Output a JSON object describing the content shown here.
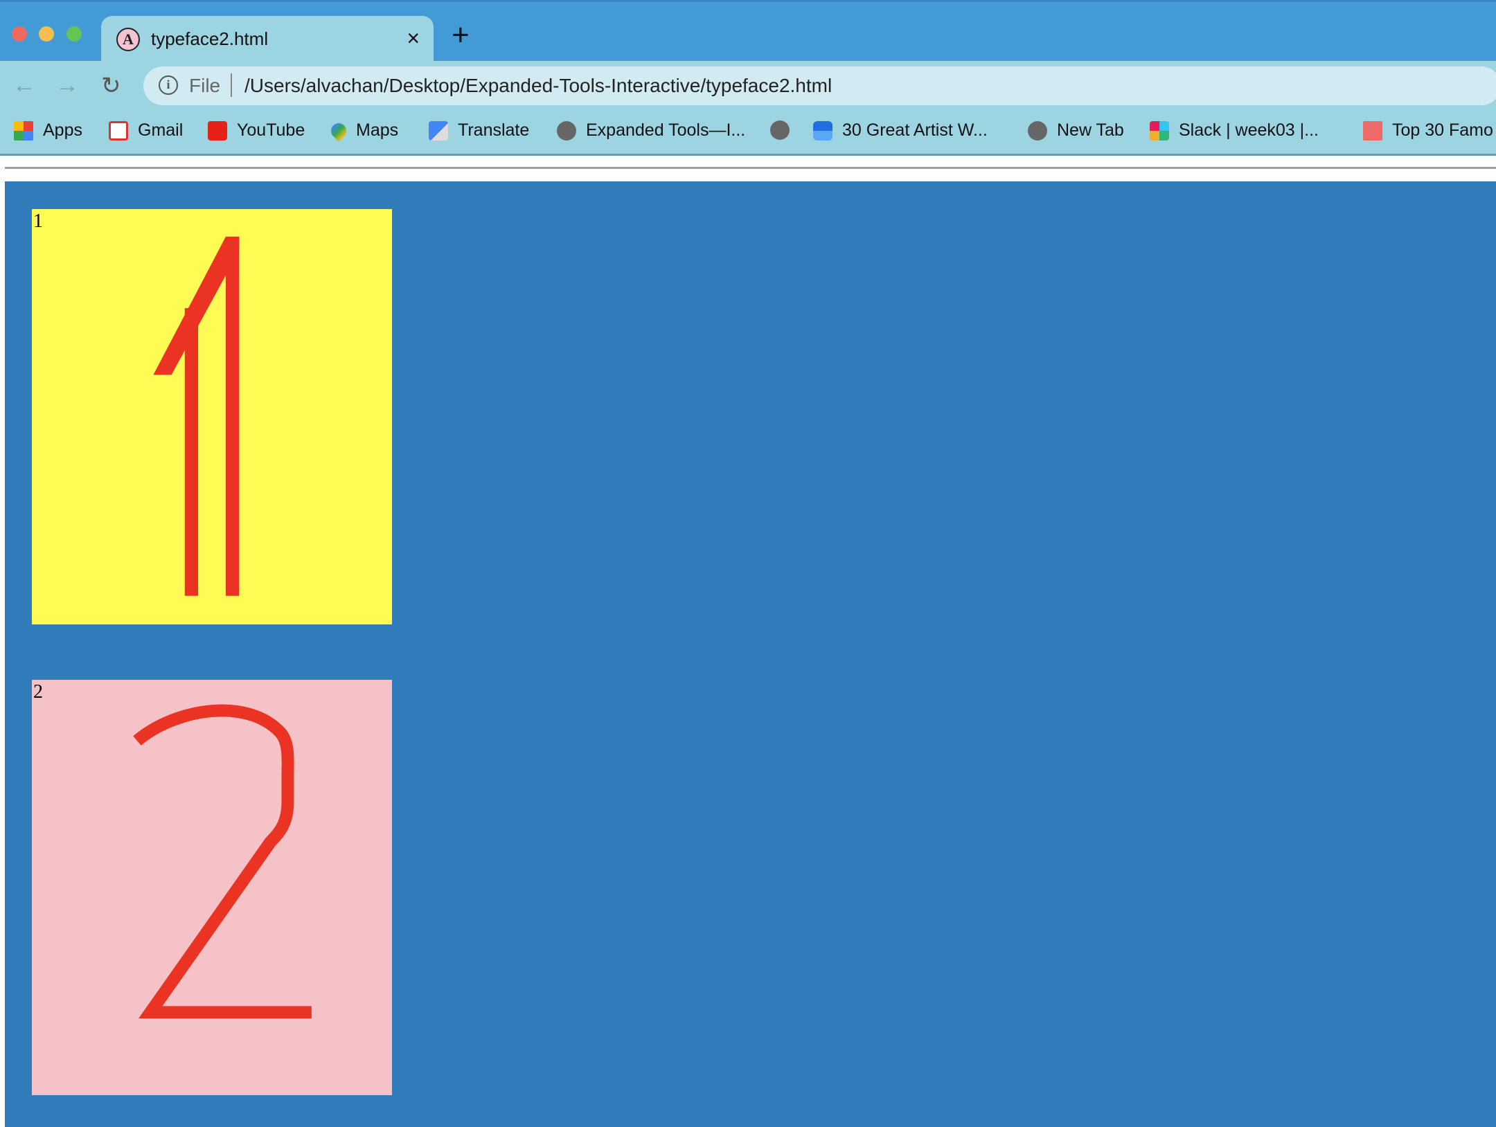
{
  "browser": {
    "tab": {
      "title": "typeface2.html",
      "close_label": "×"
    },
    "new_tab_label": "+",
    "address": {
      "scheme_label": "File",
      "url": "/Users/alvachan/Desktop/Expanded-Tools-Interactive/typeface2.html"
    },
    "bookmarks": [
      {
        "label": "Apps",
        "icon": "apps-grid-icon"
      },
      {
        "label": "Gmail",
        "icon": "gmail-icon"
      },
      {
        "label": "YouTube",
        "icon": "youtube-icon"
      },
      {
        "label": "Maps",
        "icon": "maps-icon"
      },
      {
        "label": "Translate",
        "icon": "translate-icon"
      },
      {
        "label": "Expanded Tools—I...",
        "icon": "globe-icon"
      },
      {
        "label": "",
        "icon": "globe-icon"
      },
      {
        "label": "30 Great Artist W...",
        "icon": "cube-icon"
      },
      {
        "label": "New Tab",
        "icon": "globe-icon"
      },
      {
        "label": "Slack | week03 |...",
        "icon": "slack-icon"
      },
      {
        "label": "Top 30 Famo",
        "icon": "bookmark-flag-icon"
      }
    ]
  },
  "page": {
    "boxes": [
      {
        "label": "1",
        "glyph": "1",
        "background": "#fffb55",
        "stroke": "#ea3323"
      },
      {
        "label": "2",
        "glyph": "2",
        "background": "#f5c2c7",
        "stroke": "#ea3323"
      }
    ],
    "background": "#307bba"
  }
}
